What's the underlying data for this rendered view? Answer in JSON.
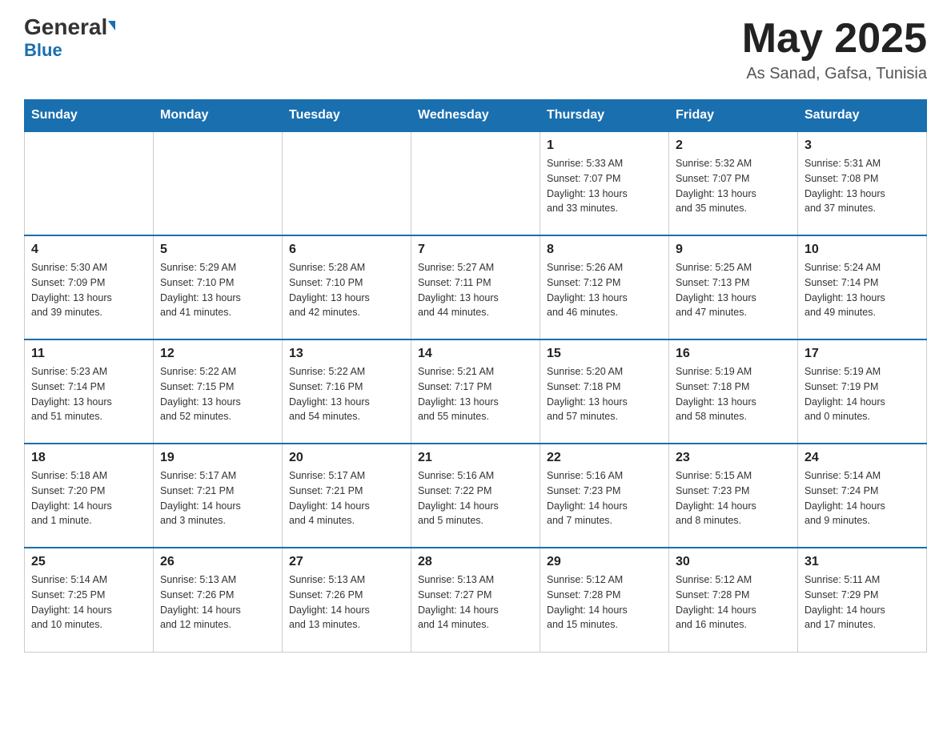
{
  "header": {
    "logo_general": "General",
    "logo_blue": "Blue",
    "month_year": "May 2025",
    "location": "As Sanad, Gafsa, Tunisia"
  },
  "days_of_week": [
    "Sunday",
    "Monday",
    "Tuesday",
    "Wednesday",
    "Thursday",
    "Friday",
    "Saturday"
  ],
  "weeks": [
    [
      {
        "day": "",
        "info": ""
      },
      {
        "day": "",
        "info": ""
      },
      {
        "day": "",
        "info": ""
      },
      {
        "day": "",
        "info": ""
      },
      {
        "day": "1",
        "info": "Sunrise: 5:33 AM\nSunset: 7:07 PM\nDaylight: 13 hours\nand 33 minutes."
      },
      {
        "day": "2",
        "info": "Sunrise: 5:32 AM\nSunset: 7:07 PM\nDaylight: 13 hours\nand 35 minutes."
      },
      {
        "day": "3",
        "info": "Sunrise: 5:31 AM\nSunset: 7:08 PM\nDaylight: 13 hours\nand 37 minutes."
      }
    ],
    [
      {
        "day": "4",
        "info": "Sunrise: 5:30 AM\nSunset: 7:09 PM\nDaylight: 13 hours\nand 39 minutes."
      },
      {
        "day": "5",
        "info": "Sunrise: 5:29 AM\nSunset: 7:10 PM\nDaylight: 13 hours\nand 41 minutes."
      },
      {
        "day": "6",
        "info": "Sunrise: 5:28 AM\nSunset: 7:10 PM\nDaylight: 13 hours\nand 42 minutes."
      },
      {
        "day": "7",
        "info": "Sunrise: 5:27 AM\nSunset: 7:11 PM\nDaylight: 13 hours\nand 44 minutes."
      },
      {
        "day": "8",
        "info": "Sunrise: 5:26 AM\nSunset: 7:12 PM\nDaylight: 13 hours\nand 46 minutes."
      },
      {
        "day": "9",
        "info": "Sunrise: 5:25 AM\nSunset: 7:13 PM\nDaylight: 13 hours\nand 47 minutes."
      },
      {
        "day": "10",
        "info": "Sunrise: 5:24 AM\nSunset: 7:14 PM\nDaylight: 13 hours\nand 49 minutes."
      }
    ],
    [
      {
        "day": "11",
        "info": "Sunrise: 5:23 AM\nSunset: 7:14 PM\nDaylight: 13 hours\nand 51 minutes."
      },
      {
        "day": "12",
        "info": "Sunrise: 5:22 AM\nSunset: 7:15 PM\nDaylight: 13 hours\nand 52 minutes."
      },
      {
        "day": "13",
        "info": "Sunrise: 5:22 AM\nSunset: 7:16 PM\nDaylight: 13 hours\nand 54 minutes."
      },
      {
        "day": "14",
        "info": "Sunrise: 5:21 AM\nSunset: 7:17 PM\nDaylight: 13 hours\nand 55 minutes."
      },
      {
        "day": "15",
        "info": "Sunrise: 5:20 AM\nSunset: 7:18 PM\nDaylight: 13 hours\nand 57 minutes."
      },
      {
        "day": "16",
        "info": "Sunrise: 5:19 AM\nSunset: 7:18 PM\nDaylight: 13 hours\nand 58 minutes."
      },
      {
        "day": "17",
        "info": "Sunrise: 5:19 AM\nSunset: 7:19 PM\nDaylight: 14 hours\nand 0 minutes."
      }
    ],
    [
      {
        "day": "18",
        "info": "Sunrise: 5:18 AM\nSunset: 7:20 PM\nDaylight: 14 hours\nand 1 minute."
      },
      {
        "day": "19",
        "info": "Sunrise: 5:17 AM\nSunset: 7:21 PM\nDaylight: 14 hours\nand 3 minutes."
      },
      {
        "day": "20",
        "info": "Sunrise: 5:17 AM\nSunset: 7:21 PM\nDaylight: 14 hours\nand 4 minutes."
      },
      {
        "day": "21",
        "info": "Sunrise: 5:16 AM\nSunset: 7:22 PM\nDaylight: 14 hours\nand 5 minutes."
      },
      {
        "day": "22",
        "info": "Sunrise: 5:16 AM\nSunset: 7:23 PM\nDaylight: 14 hours\nand 7 minutes."
      },
      {
        "day": "23",
        "info": "Sunrise: 5:15 AM\nSunset: 7:23 PM\nDaylight: 14 hours\nand 8 minutes."
      },
      {
        "day": "24",
        "info": "Sunrise: 5:14 AM\nSunset: 7:24 PM\nDaylight: 14 hours\nand 9 minutes."
      }
    ],
    [
      {
        "day": "25",
        "info": "Sunrise: 5:14 AM\nSunset: 7:25 PM\nDaylight: 14 hours\nand 10 minutes."
      },
      {
        "day": "26",
        "info": "Sunrise: 5:13 AM\nSunset: 7:26 PM\nDaylight: 14 hours\nand 12 minutes."
      },
      {
        "day": "27",
        "info": "Sunrise: 5:13 AM\nSunset: 7:26 PM\nDaylight: 14 hours\nand 13 minutes."
      },
      {
        "day": "28",
        "info": "Sunrise: 5:13 AM\nSunset: 7:27 PM\nDaylight: 14 hours\nand 14 minutes."
      },
      {
        "day": "29",
        "info": "Sunrise: 5:12 AM\nSunset: 7:28 PM\nDaylight: 14 hours\nand 15 minutes."
      },
      {
        "day": "30",
        "info": "Sunrise: 5:12 AM\nSunset: 7:28 PM\nDaylight: 14 hours\nand 16 minutes."
      },
      {
        "day": "31",
        "info": "Sunrise: 5:11 AM\nSunset: 7:29 PM\nDaylight: 14 hours\nand 17 minutes."
      }
    ]
  ]
}
